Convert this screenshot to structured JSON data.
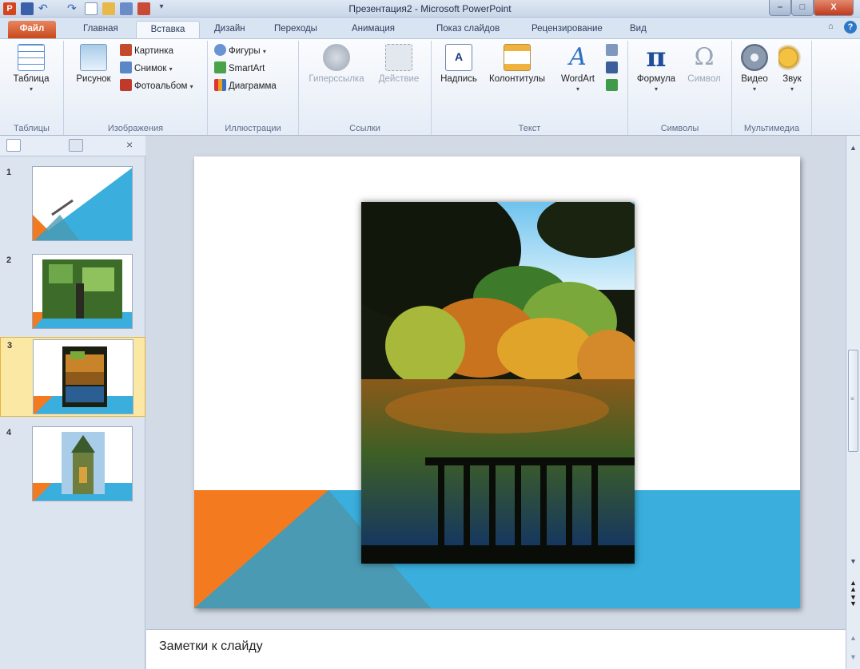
{
  "window": {
    "title": "Презентация2 - Microsoft PowerPoint",
    "app_logo": "P",
    "controls": {
      "minimize": "–",
      "maximize": "□",
      "close": "X"
    }
  },
  "tabs": {
    "file": "Файл",
    "home": "Главная",
    "insert": "Вставка",
    "design": "Дизайн",
    "transitions": "Переходы",
    "animations": "Анимация",
    "slideshow": "Показ слайдов",
    "review": "Рецензирование",
    "view": "Вид",
    "active": "Вставка"
  },
  "ribbon": {
    "tables": {
      "label": "Таблицы",
      "table": "Таблица"
    },
    "images": {
      "label": "Изображения",
      "picture": "Рисунок",
      "clipart": "Картинка",
      "screenshot": "Снимок",
      "photoalbum": "Фотоальбом"
    },
    "illustrations": {
      "label": "Иллюстрации",
      "shapes": "Фигуры",
      "smartart": "SmartArt",
      "chart": "Диаграмма"
    },
    "links": {
      "label": "Ссылки",
      "hyperlink": "Гиперссылка",
      "action": "Действие"
    },
    "text": {
      "label": "Текст",
      "textbox": "Надпись",
      "headerfooter": "Колонтитулы",
      "wordart": "WordArt"
    },
    "symbols": {
      "label": "Символы",
      "equation": "Формула",
      "symbol": "Символ",
      "pi_glyph": "π",
      "omega_glyph": "Ω"
    },
    "media": {
      "label": "Мультимедиа",
      "video": "Видео",
      "audio": "Звук"
    }
  },
  "slides_panel": {
    "selected": 3,
    "items": [
      {
        "number": "1",
        "thumbnail": "title-slide"
      },
      {
        "number": "2",
        "thumbnail": "tree-photo"
      },
      {
        "number": "3",
        "thumbnail": "autumn-lake-photo"
      },
      {
        "number": "4",
        "thumbnail": "cathedral-photo"
      }
    ]
  },
  "slide": {
    "image": "autumn-lake-photo",
    "colors": {
      "orange": "#f47a20",
      "blue": "#3aaedc",
      "teal": "#4a9ab3"
    }
  },
  "notes": {
    "placeholder": "Заметки к слайду"
  }
}
